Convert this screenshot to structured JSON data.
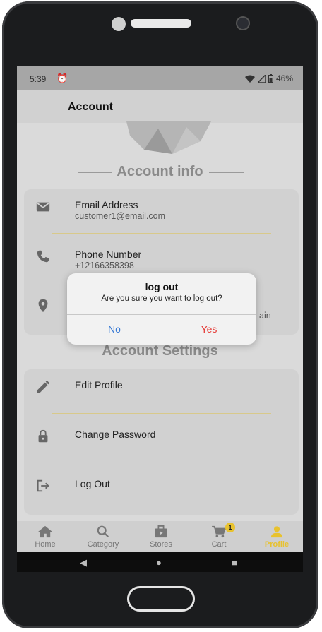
{
  "status_bar": {
    "time": "5:39",
    "battery": "46%"
  },
  "app_bar": {
    "title": "Account"
  },
  "account_info": {
    "heading": "Account info",
    "items": [
      {
        "label": "Email Address",
        "value": "customer1@email.com",
        "icon": "email-icon"
      },
      {
        "label": "Phone Number",
        "value": "+12166358398",
        "icon": "phone-icon"
      },
      {
        "label": "",
        "value": "ain",
        "icon": "location-icon"
      }
    ]
  },
  "account_settings": {
    "heading": "Account Settings",
    "items": [
      {
        "label": "Edit Profile",
        "icon": "pencil-icon"
      },
      {
        "label": "Change Password",
        "icon": "lock-icon"
      },
      {
        "label": "Log Out",
        "icon": "logout-icon"
      }
    ]
  },
  "bottom_nav": {
    "items": [
      {
        "label": "Home",
        "icon": "home-icon"
      },
      {
        "label": "Category",
        "icon": "search-icon"
      },
      {
        "label": "Stores",
        "icon": "store-icon"
      },
      {
        "label": "Cart",
        "icon": "cart-icon",
        "badge": "1"
      },
      {
        "label": "Profile",
        "icon": "person-icon",
        "active": true
      }
    ]
  },
  "dialog": {
    "title": "log out",
    "message": "Are you sure you want to log out?",
    "no_label": "No",
    "yes_label": "Yes"
  },
  "colors": {
    "accent": "#e8c22e",
    "no": "#3a7bd5",
    "yes": "#e53935"
  }
}
